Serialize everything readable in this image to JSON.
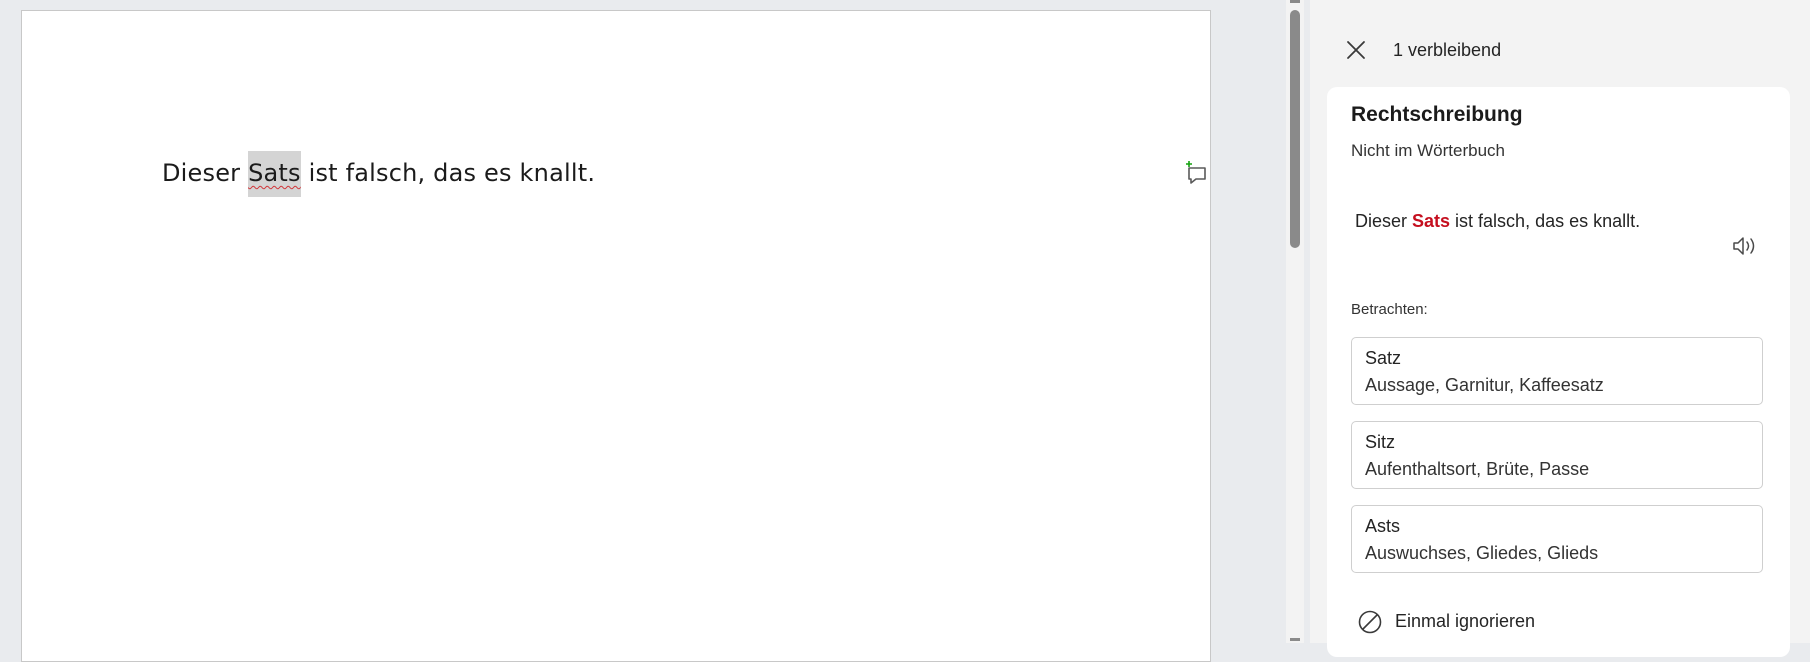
{
  "document": {
    "sentence_before": "Dieser ",
    "sentence_error": "Sats",
    "sentence_after": " ist falsch, das es knallt.",
    "comment_icon": "new-comment-icon"
  },
  "pane": {
    "close_icon": "close-icon",
    "remaining": "1 verbleibend",
    "card": {
      "title": "Rechtschreibung",
      "subtitle": "Nicht im Wörterbuch",
      "sentence_before": "Dieser ",
      "sentence_error": "Sats",
      "sentence_after": " ist falsch, das es knallt.",
      "speak_icon": "read-aloud-icon",
      "consider_label": "Betrachten:",
      "suggestions": [
        {
          "word": "Satz",
          "synonyms": "Aussage, Garnitur, Kaffeesatz"
        },
        {
          "word": "Sitz",
          "synonyms": "Aufenthaltsort, Brüte, Passe"
        },
        {
          "word": "Asts",
          "synonyms": "Auswuchses, Gliedes, Glieds"
        }
      ],
      "ignore_label": "Einmal ignorieren",
      "ignore_icon": "ignore-icon"
    }
  },
  "colors": {
    "error_text": "#c50f1f",
    "squiggle": "#d13438",
    "comment_plus": "#13a10e"
  }
}
